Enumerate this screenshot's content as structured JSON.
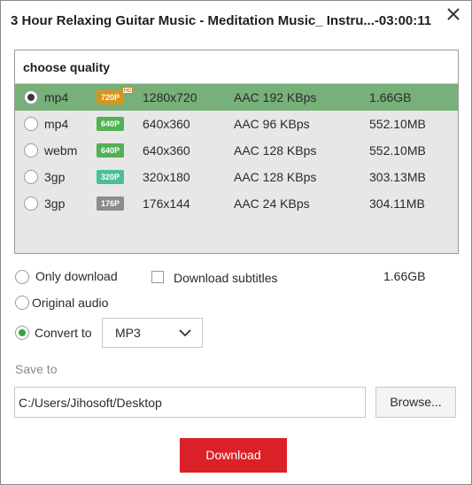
{
  "window": {
    "title": "3 Hour Relaxing Guitar Music - Meditation Music_ Instru...-03:00:11",
    "close_icon": "close-icon"
  },
  "quality": {
    "header": "choose quality",
    "rows": [
      {
        "format": "mp4",
        "badge": "720P",
        "badge_color": "#d9951a",
        "hd": true,
        "resolution": "1280x720",
        "audio": "AAC 192 KBps",
        "size": "1.66GB",
        "selected": true
      },
      {
        "format": "mp4",
        "badge": "640P",
        "badge_color": "#52b152",
        "hd": false,
        "resolution": "640x360",
        "audio": "AAC 96 KBps",
        "size": "552.10MB",
        "selected": false
      },
      {
        "format": "webm",
        "badge": "640P",
        "badge_color": "#52b152",
        "hd": false,
        "resolution": "640x360",
        "audio": "AAC 128 KBps",
        "size": "552.10MB",
        "selected": false
      },
      {
        "format": "3gp",
        "badge": "320P",
        "badge_color": "#4cbf94",
        "hd": false,
        "resolution": "320x180",
        "audio": "AAC 128 KBps",
        "size": "303.13MB",
        "selected": false
      },
      {
        "format": "3gp",
        "badge": "176P",
        "badge_color": "#8c8c8c",
        "hd": false,
        "resolution": "176x144",
        "audio": "AAC 24 KBps",
        "size": "304.11MB",
        "selected": false
      }
    ],
    "hd_label": "HD"
  },
  "options": {
    "only_download": "Only download",
    "download_subtitles": "Download subtitles",
    "total_size": "1.66GB",
    "original_audio": "Original audio",
    "convert_to": "Convert to",
    "convert_format": "MP3",
    "selected_option": "convert_to",
    "accent_color": "#3aa23a"
  },
  "save": {
    "label": "Save to",
    "path": "C:/Users/Jihosoft/Desktop",
    "browse": "Browse..."
  },
  "actions": {
    "download": "Download",
    "download_color": "#dc2027"
  }
}
